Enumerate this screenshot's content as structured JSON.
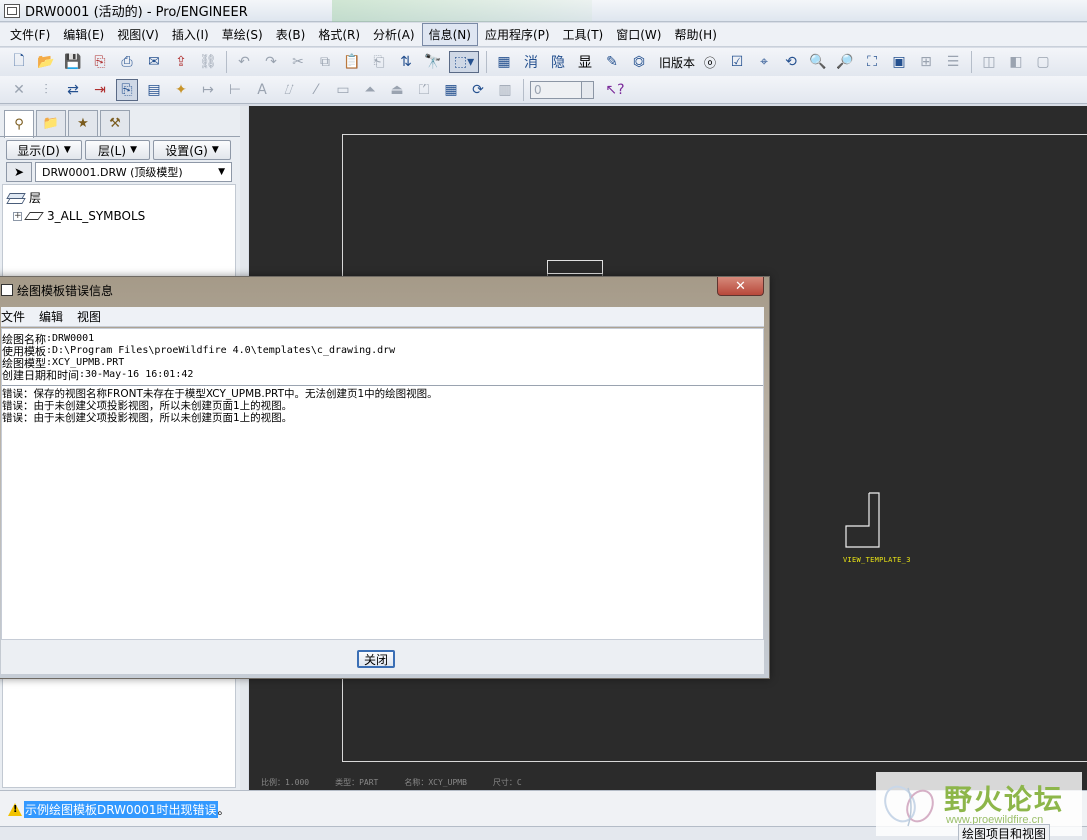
{
  "window": {
    "title": "DRW0001 (活动的) - Pro/ENGINEER"
  },
  "menubar": {
    "items": [
      {
        "label": "文件(F)"
      },
      {
        "label": "编辑(E)"
      },
      {
        "label": "视图(V)"
      },
      {
        "label": "插入(I)"
      },
      {
        "label": "草绘(S)"
      },
      {
        "label": "表(B)"
      },
      {
        "label": "格式(R)"
      },
      {
        "label": "分析(A)"
      },
      {
        "label": "信息(N)",
        "active": true
      },
      {
        "label": "应用程序(P)"
      },
      {
        "label": "工具(T)"
      },
      {
        "label": "窗口(W)"
      },
      {
        "label": "帮助(H)"
      }
    ]
  },
  "toolbar": {
    "old_version_label": "旧版本",
    "old_version_glyph": "ⓞ",
    "xiao_label": "消",
    "yin_label": "隐",
    "xian_label": "显",
    "scale_value": "0"
  },
  "left_panel": {
    "buttons": {
      "display": "显示(D)",
      "layer": "层(L)",
      "settings": "设置(G)"
    },
    "model_select": "DRW0001.DRW (顶级模型)",
    "tree": {
      "root_label": "层",
      "item_label": "3_ALL_SYMBOLS"
    }
  },
  "drawing": {
    "view_label": "VIEW_TEMPLATE_3",
    "bottom_info": [
      "比例：1.000",
      "类型：PART",
      "名称：XCY_UPMB",
      "尺寸：C"
    ]
  },
  "dialog": {
    "title": "绘图模板错误信息",
    "menu": [
      "文件",
      "编辑",
      "视图"
    ],
    "info_lines": [
      {
        "label": "绘图名称",
        "value": ":DRW0001"
      },
      {
        "label": "使用模板",
        "value": ":D:\\Program Files\\proeWildfire 4.0\\templates\\c_drawing.drw"
      },
      {
        "label": "绘图模型",
        "value": ":XCY_UPMB.PRT"
      },
      {
        "label": "创建日期和时间",
        "value": ":30-May-16 16:01:42"
      }
    ],
    "error_lines": [
      "错误：保存的视图名称FRONT未存在于模型XCY_UPMB.PRT中。无法创建页1中的绘图视图。",
      "错误：由于未创建父项投影视图，所以未创建页面1上的视图。",
      "错误：由于未创建父项投影视图，所以未创建页面1上的视图。"
    ],
    "close_button": "关闭"
  },
  "statusbar": {
    "message": "示例绘图模板DRW0001时出现错误",
    "message_end": "。",
    "filter_label": "绘图项目和视图"
  },
  "watermark": {
    "title": "野火论坛",
    "url": "www.proewildfire.cn"
  }
}
